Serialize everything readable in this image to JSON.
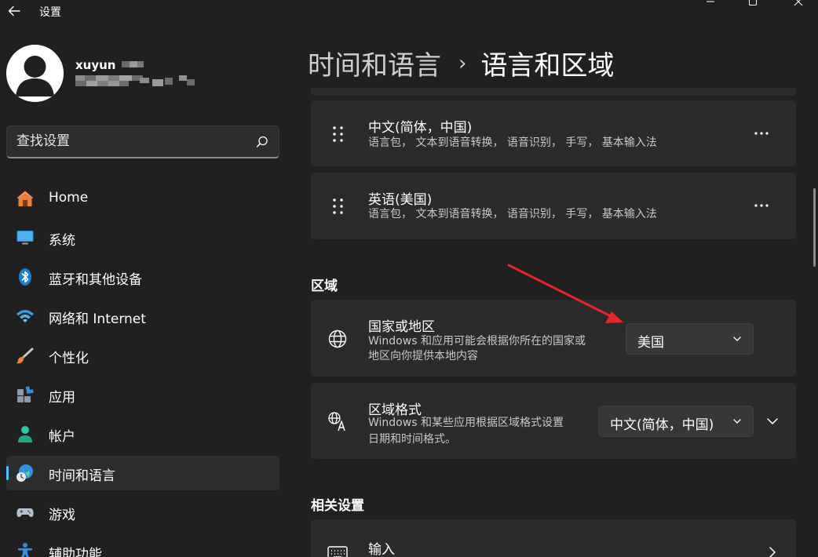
{
  "window": {
    "title": "设置"
  },
  "user": {
    "name": "xuyun",
    "name_masked": "··n"
  },
  "search": {
    "placeholder": "查找设置"
  },
  "sidebar": {
    "items": [
      {
        "label": "Home",
        "icon": "home-icon"
      },
      {
        "label": "系统",
        "icon": "system-icon"
      },
      {
        "label": "蓝牙和其他设备",
        "icon": "bluetooth-icon"
      },
      {
        "label": "网络和 Internet",
        "icon": "wifi-icon"
      },
      {
        "label": "个性化",
        "icon": "brush-icon"
      },
      {
        "label": "应用",
        "icon": "apps-icon"
      },
      {
        "label": "帐户",
        "icon": "account-icon"
      },
      {
        "label": "时间和语言",
        "icon": "time-language-icon",
        "active": true
      },
      {
        "label": "游戏",
        "icon": "gaming-icon"
      },
      {
        "label": "辅助功能",
        "icon": "accessibility-icon"
      }
    ]
  },
  "breadcrumb": {
    "parent": "时间和语言",
    "separator": "›",
    "current": "语言和区域"
  },
  "languages": [
    {
      "name": "中文(简体，中国)",
      "features": "语言包， 文本到语音转换， 语音识别， 手写， 基本输入法"
    },
    {
      "name": "英语(美国)",
      "features": "语言包， 文本到语音转换， 语音识别， 手写， 基本输入法"
    }
  ],
  "region": {
    "section_title": "区域",
    "country": {
      "title": "国家或地区",
      "desc_line1": "Windows 和应用可能会根据你所在的国家或",
      "desc_line2": "地区向你提供本地内容",
      "value": "美国"
    },
    "format": {
      "title": "区域格式",
      "desc_line1": "Windows 和某些应用根据区域格式设置",
      "desc_line2": "日期和时间格式。",
      "value": "中文(简体，中国)"
    }
  },
  "related": {
    "section_title": "相关设置",
    "input": {
      "title": "输入"
    }
  },
  "colors": {
    "background": "#202020",
    "card": "#2b2b2b",
    "accent": "#4cc2ff",
    "annotation_arrow": "#e8262a"
  }
}
